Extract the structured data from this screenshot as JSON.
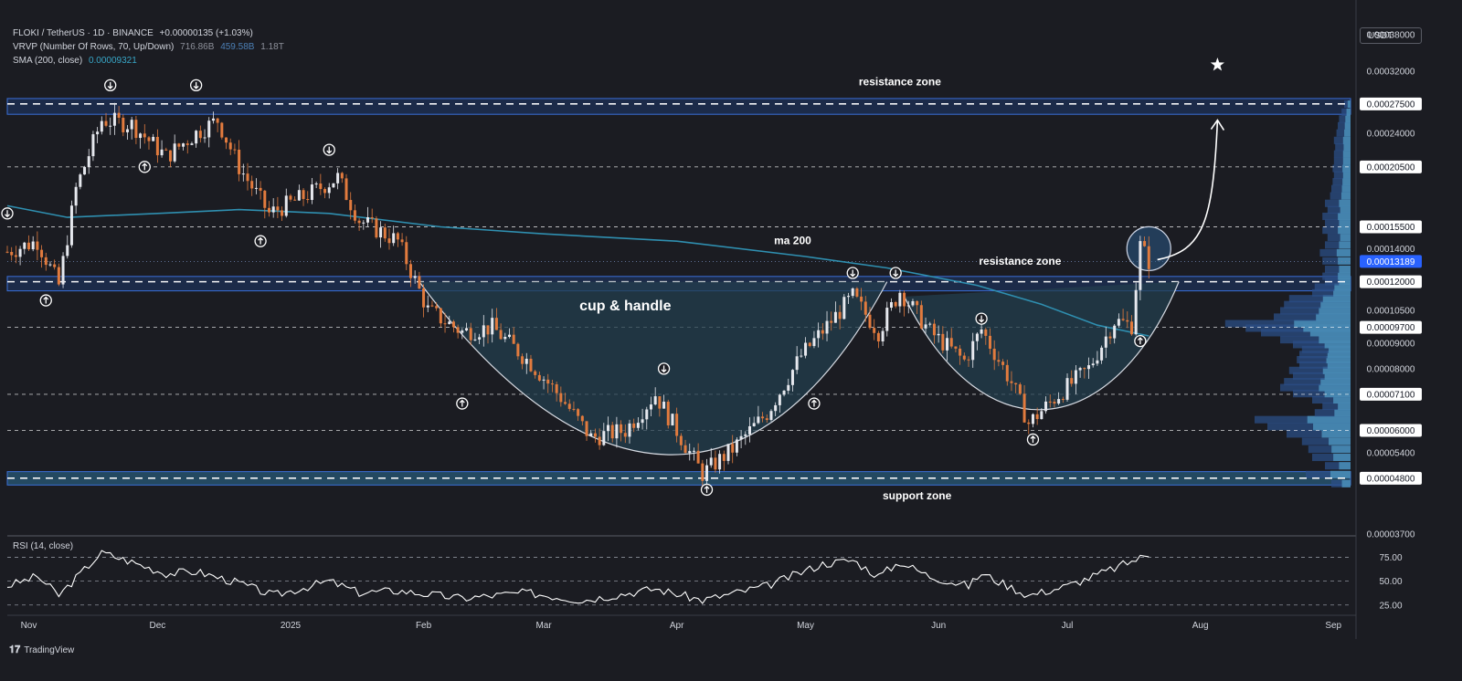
{
  "header": {
    "symbol_line": "FLOKI / TetherUS · 1D · BINANCE",
    "change": "+0.00000135 (+1.03%)",
    "vrvp_label": "VRVP (Number Of Rows, 70, Up/Down)",
    "vrvp_v1": "716.86B",
    "vrvp_v2": "459.58B",
    "vrvp_v3": "1.18T",
    "sma_label": "SMA (200, close)",
    "sma_value": "0.00009321"
  },
  "price_axis": {
    "currency": "USDT",
    "labels": [
      {
        "value": 0.00038,
        "text": "0.00038000",
        "type": "tick"
      },
      {
        "value": 0.00032,
        "text": "0.00032000",
        "type": "tick"
      },
      {
        "value": 0.000275,
        "text": "0.00027500",
        "type": "level"
      },
      {
        "value": 0.00024,
        "text": "0.00024000",
        "type": "tick"
      },
      {
        "value": 0.000205,
        "text": "0.00020500",
        "type": "level"
      },
      {
        "value": 0.000155,
        "text": "0.00015500",
        "type": "level"
      },
      {
        "value": 0.00014,
        "text": "0.00014000",
        "type": "tick"
      },
      {
        "value": 0.00013189,
        "text": "0.00013189",
        "type": "current"
      },
      {
        "value": 0.00012,
        "text": "0.00012000",
        "type": "level"
      },
      {
        "value": 0.000105,
        "text": "0.00010500",
        "type": "tick"
      },
      {
        "value": 9.7e-05,
        "text": "0.00009700",
        "type": "level"
      },
      {
        "value": 9e-05,
        "text": "0.00009000",
        "type": "tick"
      },
      {
        "value": 8e-05,
        "text": "0.00008000",
        "type": "tick"
      },
      {
        "value": 7.1e-05,
        "text": "0.00007100",
        "type": "level"
      },
      {
        "value": 6e-05,
        "text": "0.00006000",
        "type": "level"
      },
      {
        "value": 5.4e-05,
        "text": "0.00005400",
        "type": "tick"
      },
      {
        "value": 4.8e-05,
        "text": "0.00004800",
        "type": "level"
      },
      {
        "value": 3.7e-05,
        "text": "0.00003700",
        "type": "tick"
      }
    ]
  },
  "rsi_panel": {
    "label": "RSI (14, close)",
    "ticks": [
      "75.00",
      "50.00",
      "25.00"
    ]
  },
  "time_axis": [
    "Nov",
    "Dec",
    "2025",
    "Feb",
    "Mar",
    "Apr",
    "May",
    "Jun",
    "Jul",
    "Aug",
    "Sep"
  ],
  "annotations": {
    "resistance_top": "resistance zone",
    "resistance_mid": "resistance zone",
    "support": "support zone",
    "ma": "ma 200",
    "pattern": "cup & handle"
  },
  "brand": "TradingView",
  "colors": {
    "background": "#1b1c22",
    "up_candle": "#e6e8ee",
    "down_candle": "#e27b3e",
    "sma": "#2f8fb0",
    "zone": "#1f3f7a",
    "support_zone": "#2b6f96",
    "cup_fill": "#233e4d",
    "rsi": "#ffffff"
  },
  "chart_data": {
    "type": "candlestick",
    "x_range": [
      "2024-10-27",
      "2025-09-05"
    ],
    "y_scale": "log",
    "ylim": [
      3.7e-05,
      0.00041
    ],
    "dashed_levels": [
      0.000275,
      0.000205,
      0.000155,
      0.00012,
      9.7e-05,
      7.1e-05,
      6e-05,
      4.8e-05
    ],
    "zones": [
      {
        "label": "resistance zone",
        "low": 0.000262,
        "high": 0.000282
      },
      {
        "label": "resistance zone",
        "low": 0.000115,
        "high": 0.000123
      },
      {
        "label": "support zone",
        "low": 4.65e-05,
        "high": 4.95e-05
      }
    ],
    "closes": [
      [
        "2024-10-27",
        0.000138
      ],
      [
        "2024-11-03",
        0.000145
      ],
      [
        "2024-11-08",
        0.000118
      ],
      [
        "2024-11-12",
        0.000185
      ],
      [
        "2024-11-18",
        0.000255
      ],
      [
        "2024-11-25",
        0.00025
      ],
      [
        "2024-12-03",
        0.000215
      ],
      [
        "2024-12-10",
        0.00024
      ],
      [
        "2024-12-15",
        0.000255
      ],
      [
        "2024-12-20",
        0.000205
      ],
      [
        "2024-12-27",
        0.000165
      ],
      [
        "2025-01-05",
        0.00018
      ],
      [
        "2025-01-12",
        0.000195
      ],
      [
        "2025-01-17",
        0.00016
      ],
      [
        "2025-01-26",
        0.000145
      ],
      [
        "2025-02-02",
        0.000105
      ],
      [
        "2025-02-10",
        9.5e-05
      ],
      [
        "2025-02-17",
        9.7e-05
      ],
      [
        "2025-02-26",
        8.2e-05
      ],
      [
        "2025-03-05",
        7e-05
      ],
      [
        "2025-03-12",
        5.8e-05
      ],
      [
        "2025-03-20",
        6e-05
      ],
      [
        "2025-03-27",
        7.1e-05
      ],
      [
        "2025-04-03",
        5.6e-05
      ],
      [
        "2025-04-07",
        4.9e-05
      ],
      [
        "2025-04-14",
        5.5e-05
      ],
      [
        "2025-04-22",
        6.5e-05
      ],
      [
        "2025-04-30",
        8.5e-05
      ],
      [
        "2025-05-07",
        0.0001
      ],
      [
        "2025-05-12",
        0.000112
      ],
      [
        "2025-05-18",
        9.5e-05
      ],
      [
        "2025-05-23",
        0.000115
      ],
      [
        "2025-05-30",
        9.5e-05
      ],
      [
        "2025-06-07",
        8.3e-05
      ],
      [
        "2025-06-11",
        9.6e-05
      ],
      [
        "2025-06-18",
        7.5e-05
      ],
      [
        "2025-06-22",
        6.2e-05
      ],
      [
        "2025-06-29",
        7.1e-05
      ],
      [
        "2025-07-06",
        8e-05
      ],
      [
        "2025-07-12",
        0.0001
      ],
      [
        "2025-07-16",
        9.8e-05
      ],
      [
        "2025-07-18",
        0.000142
      ],
      [
        "2025-07-20",
        0.00013189
      ]
    ],
    "sma_200": [
      [
        "2024-10-27",
        0.000171
      ],
      [
        "2024-11-10",
        0.000162
      ],
      [
        "2024-12-01",
        0.000165
      ],
      [
        "2024-12-20",
        0.000168
      ],
      [
        "2025-01-10",
        0.000165
      ],
      [
        "2025-02-05",
        0.000155
      ],
      [
        "2025-03-01",
        0.00015
      ],
      [
        "2025-04-01",
        0.000145
      ],
      [
        "2025-05-01",
        0.000135
      ],
      [
        "2025-05-20",
        0.000128
      ],
      [
        "2025-06-10",
        0.000118
      ],
      [
        "2025-06-25",
        0.000108
      ],
      [
        "2025-07-08",
        9.8e-05
      ],
      [
        "2025-07-20",
        9.321e-05
      ]
    ],
    "rsi_14": [
      [
        "2024-10-27",
        45
      ],
      [
        "2024-11-03",
        55
      ],
      [
        "2024-11-08",
        35
      ],
      [
        "2024-11-18",
        80
      ],
      [
        "2024-11-25",
        70
      ],
      [
        "2024-12-03",
        58
      ],
      [
        "2024-12-10",
        60
      ],
      [
        "2024-12-20",
        48
      ],
      [
        "2024-12-28",
        35
      ],
      [
        "2025-01-10",
        50
      ],
      [
        "2025-01-17",
        38
      ],
      [
        "2025-01-26",
        40
      ],
      [
        "2025-02-10",
        32
      ],
      [
        "2025-02-25",
        38
      ],
      [
        "2025-03-10",
        30
      ],
      [
        "2025-03-27",
        42
      ],
      [
        "2025-04-07",
        30
      ],
      [
        "2025-04-22",
        45
      ],
      [
        "2025-05-05",
        68
      ],
      [
        "2025-05-12",
        72
      ],
      [
        "2025-05-18",
        55
      ],
      [
        "2025-05-23",
        70
      ],
      [
        "2025-05-30",
        55
      ],
      [
        "2025-06-08",
        45
      ],
      [
        "2025-06-11",
        58
      ],
      [
        "2025-06-22",
        35
      ],
      [
        "2025-07-01",
        45
      ],
      [
        "2025-07-10",
        60
      ],
      [
        "2025-07-20",
        78
      ]
    ],
    "markers": [
      {
        "date": "2024-10-27",
        "price": 0.000165,
        "dir": "down"
      },
      {
        "date": "2024-11-05",
        "price": 0.00011,
        "dir": "up"
      },
      {
        "date": "2024-11-20",
        "price": 0.0003,
        "dir": "down"
      },
      {
        "date": "2024-11-28",
        "price": 0.000205,
        "dir": "up"
      },
      {
        "date": "2024-12-10",
        "price": 0.0003,
        "dir": "down"
      },
      {
        "date": "2024-12-25",
        "price": 0.000145,
        "dir": "up"
      },
      {
        "date": "2025-01-10",
        "price": 0.000222,
        "dir": "down"
      },
      {
        "date": "2025-02-10",
        "price": 6.8e-05,
        "dir": "up"
      },
      {
        "date": "2025-03-29",
        "price": 8e-05,
        "dir": "down"
      },
      {
        "date": "2025-04-08",
        "price": 4.55e-05,
        "dir": "up"
      },
      {
        "date": "2025-05-03",
        "price": 6.8e-05,
        "dir": "up"
      },
      {
        "date": "2025-05-12",
        "price": 0.000125,
        "dir": "down"
      },
      {
        "date": "2025-05-22",
        "price": 0.000125,
        "dir": "down"
      },
      {
        "date": "2025-06-11",
        "price": 0.000101,
        "dir": "down"
      },
      {
        "date": "2025-06-23",
        "price": 5.75e-05,
        "dir": "up"
      },
      {
        "date": "2025-07-18",
        "price": 9.1e-05,
        "dir": "up"
      }
    ],
    "volume_profile": [
      [
        4.6e-05,
        0.15
      ],
      [
        4.8e-05,
        0.35
      ],
      [
        5e-05,
        0.2
      ],
      [
        5.2e-05,
        0.3
      ],
      [
        5.4e-05,
        0.33
      ],
      [
        5.6e-05,
        0.38
      ],
      [
        5.8e-05,
        0.5
      ],
      [
        6e-05,
        0.65
      ],
      [
        6.2e-05,
        0.75
      ],
      [
        6.4e-05,
        0.28
      ],
      [
        6.6e-05,
        0.22
      ],
      [
        6.8e-05,
        0.3
      ],
      [
        7e-05,
        0.45
      ],
      [
        7.2e-05,
        0.55
      ],
      [
        7.4e-05,
        0.52
      ],
      [
        7.6e-05,
        0.45
      ],
      [
        7.8e-05,
        0.48
      ],
      [
        8e-05,
        0.4
      ],
      [
        8.2e-05,
        0.42
      ],
      [
        8.4e-05,
        0.4
      ],
      [
        8.6e-05,
        0.38
      ],
      [
        8.8e-05,
        0.45
      ],
      [
        9e-05,
        0.55
      ],
      [
        9.3e-05,
        0.7
      ],
      [
        9.5e-05,
        0.82
      ],
      [
        9.7e-05,
        0.98
      ],
      [
        0.0001,
        0.6
      ],
      [
        0.000103,
        0.55
      ],
      [
        0.000106,
        0.52
      ],
      [
        0.000109,
        0.48
      ],
      [
        0.000112,
        0.3
      ],
      [
        0.000115,
        0.28
      ],
      [
        0.000118,
        0.2
      ],
      [
        0.000121,
        0.22
      ],
      [
        0.000125,
        0.2
      ],
      [
        0.00013,
        0.22
      ],
      [
        0.000135,
        0.24
      ],
      [
        0.00014,
        0.2
      ],
      [
        0.000145,
        0.18
      ],
      [
        0.00015,
        0.22
      ],
      [
        0.000155,
        0.2
      ],
      [
        0.00016,
        0.22
      ],
      [
        0.000165,
        0.18
      ],
      [
        0.00017,
        0.2
      ],
      [
        0.000176,
        0.16
      ],
      [
        0.000182,
        0.15
      ],
      [
        0.000188,
        0.14
      ],
      [
        0.000194,
        0.13
      ],
      [
        0.0002,
        0.14
      ],
      [
        0.000207,
        0.13
      ],
      [
        0.000214,
        0.13
      ],
      [
        0.000221,
        0.12
      ],
      [
        0.000228,
        0.13
      ],
      [
        0.000236,
        0.11
      ],
      [
        0.000244,
        0.1
      ],
      [
        0.000252,
        0.09
      ],
      [
        0.00026,
        0.07
      ],
      [
        0.00027,
        0.05
      ]
    ]
  }
}
